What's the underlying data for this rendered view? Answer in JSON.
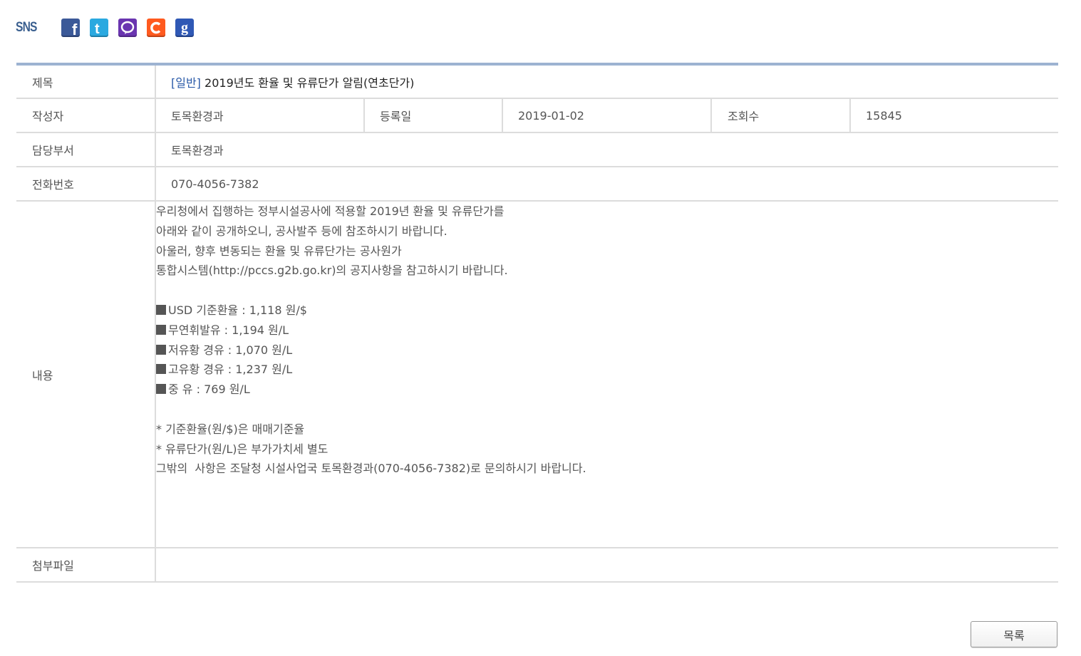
{
  "sns": {
    "label": "SNS",
    "icons": [
      {
        "name": "facebook-icon",
        "glyph": "f"
      },
      {
        "name": "twitter-icon",
        "glyph": "t"
      },
      {
        "name": "kakaotalk-icon",
        "glyph": "💬"
      },
      {
        "name": "c-share-icon",
        "glyph": "c"
      },
      {
        "name": "google-icon",
        "glyph": "g"
      }
    ]
  },
  "post": {
    "labels": {
      "title": "제목",
      "author": "작성자",
      "date": "등록일",
      "views": "조회수",
      "department": "담당부서",
      "phone": "전화번호",
      "content": "내용",
      "attachment": "첨부파일"
    },
    "category": "[일반]",
    "title": "2019년도 환율 및 유류단가 알림(연초단가)",
    "author": "토목환경과",
    "date": "2019-01-02",
    "views": "15845",
    "department": "토목환경과",
    "phone": "070-4056-7382",
    "content_lines": [
      "우리청에서 집행하는 정부시설공사에 적용할 2019년 환율 및 유류단가를",
      "아래와 같이 공개하오니, 공사발주 등에 참조하시기 바랍니다.",
      "아울러, 향후 변동되는 환율 및 유류단가는 공사원가",
      "통합시스템(http://pccs.g2b.go.kr)의 공지사항을 참고하시기 바랍니다.",
      "",
      "USD 기준환율 : 1,118 원/$",
      "무연휘발유 : 1,194 원/L",
      "저유황 경유 : 1,070 원/L",
      "고유황 경유 : 1,237 원/L",
      "중 유 : 769 원/L",
      "",
      "* 기준환율(원/$)은 매매기준율",
      "* 유류단가(원/L)은 부가가치세 별도",
      "그밖의  사항은 조달청 시설사업국 토목환경과(070-4056-7382)로 문의하시기 바랍니다."
    ],
    "attachment": ""
  },
  "buttons": {
    "list": "목록"
  }
}
